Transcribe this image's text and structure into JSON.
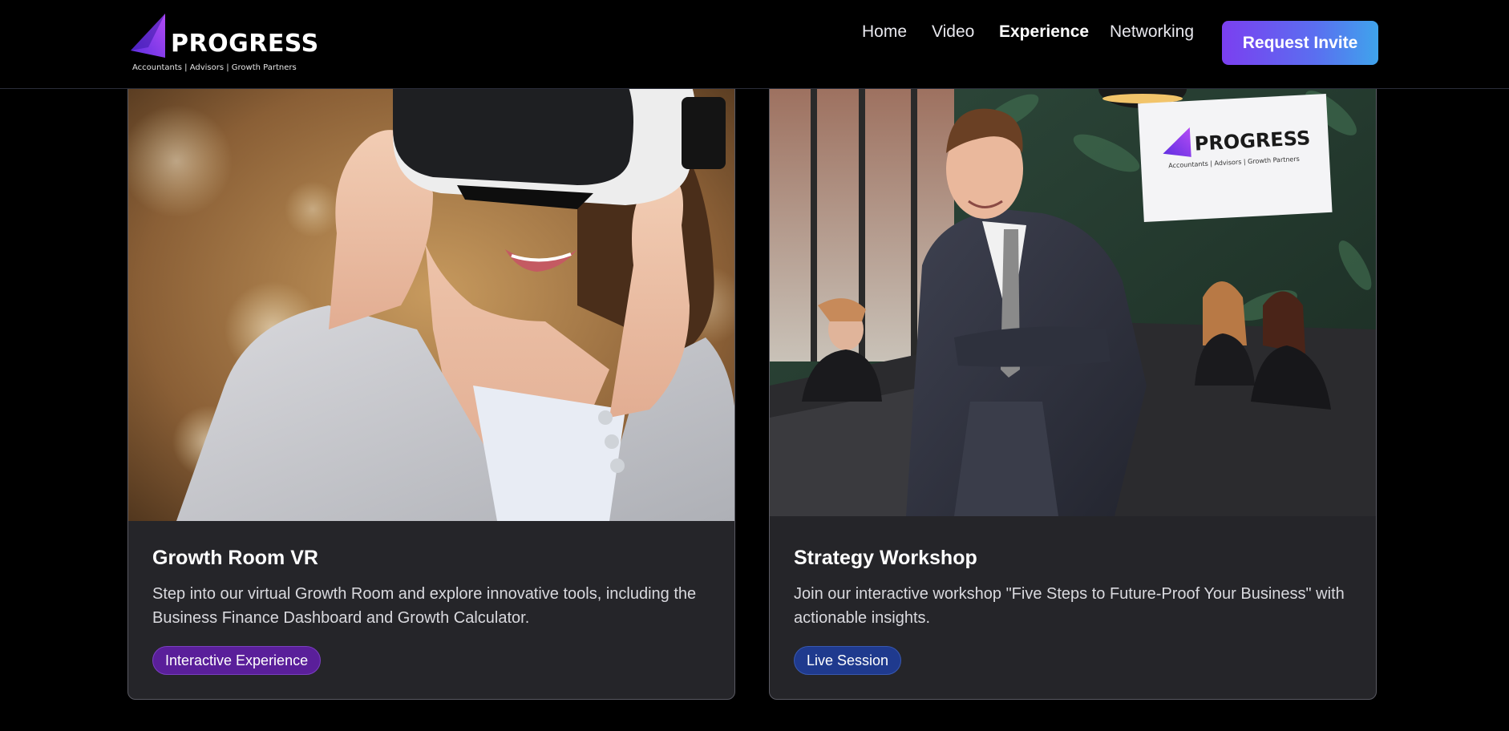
{
  "brand": {
    "name": "PROGRESS",
    "tagline": "Accountants | Advisors | Growth Partners",
    "gradient_start": "#7b3ff0",
    "gradient_end": "#3fa4ec"
  },
  "nav": {
    "items": [
      {
        "label": "Home",
        "active": false
      },
      {
        "label": "Video",
        "active": false
      },
      {
        "label": "Experience",
        "active": true
      },
      {
        "label": "Networking",
        "active": false
      }
    ],
    "cta_label": "Request Invite"
  },
  "cards": [
    {
      "title": "Growth Room VR",
      "description": "Step into our virtual Growth Room and explore innovative tools, including the Business Finance Dashboard and Growth Calculator.",
      "badge": "Interactive Experience",
      "badge_color": "#5a1f9a",
      "image": "woman-wearing-vr-headset-photo"
    },
    {
      "title": "Strategy Workshop",
      "description": "Join our interactive workshop \"Five Steps to Future-Proof Your Business\" with actionable insights.",
      "badge": "Live Session",
      "badge_color": "#1f3a8e",
      "image": "man-in-suit-at-workshop-photo",
      "screen_logo": {
        "name": "PROGRESS",
        "tagline": "Accountants | Advisors | Growth Partners"
      }
    }
  ]
}
